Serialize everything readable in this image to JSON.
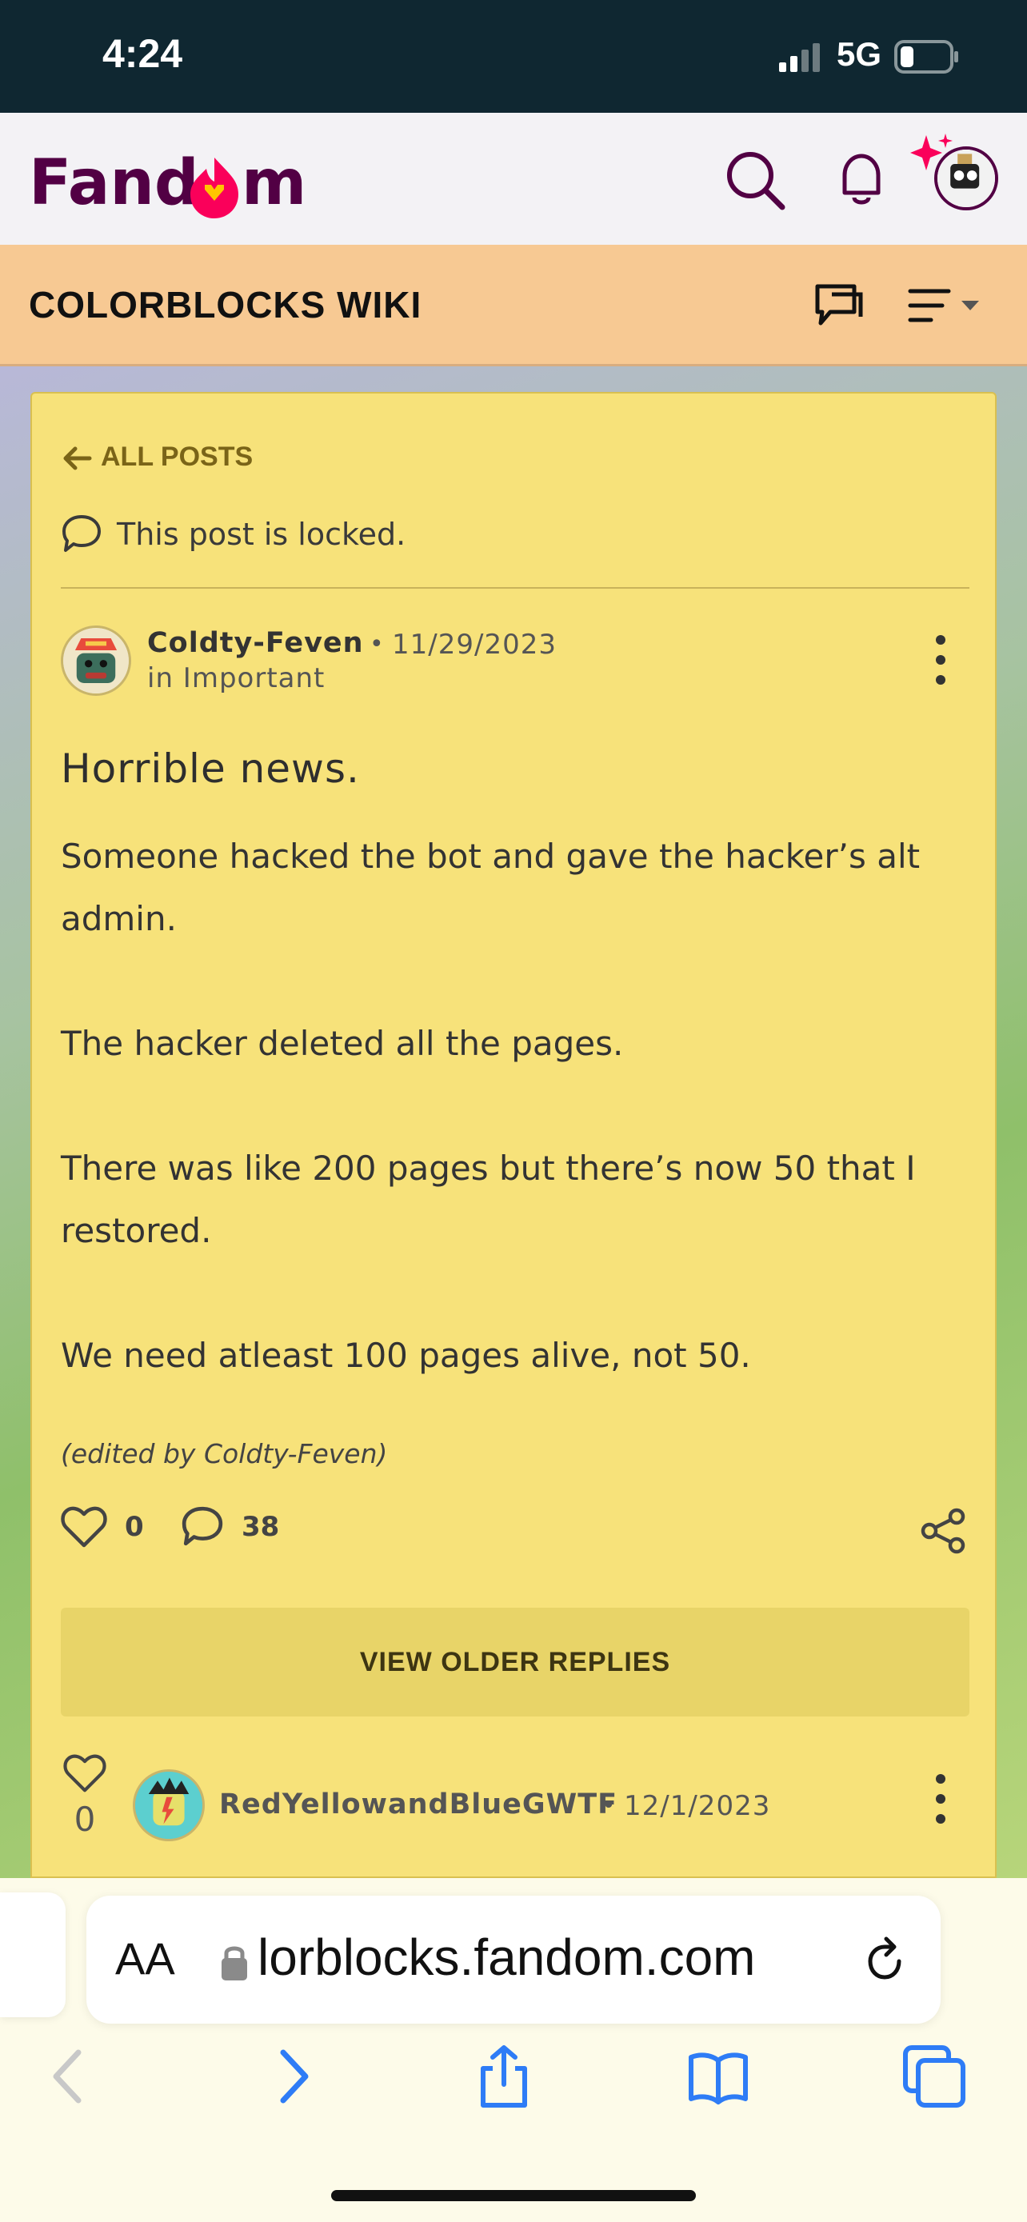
{
  "status_bar": {
    "time": "4:24",
    "network": "5G"
  },
  "fandom": {
    "logo_text": "Fandom"
  },
  "wiki": {
    "title": "COLORBLOCKS WIKI"
  },
  "post": {
    "back_label": "ALL POSTS",
    "locked_text": "This post is locked.",
    "author": "Coldty-Feven",
    "date": "11/29/2023",
    "category": "in Important",
    "title": "Horrible news.",
    "body": [
      "Someone hacked the bot and gave the hacker’s alt admin.",
      "The hacker deleted all the pages.",
      "There was like 200 pages but there’s now 50 that I restored.",
      "We need atleast 100 pages alive, not 50."
    ],
    "edited_note": "(edited by Coldty-Feven)",
    "likes": "0",
    "comments": "38"
  },
  "view_older_label": "VIEW OLDER REPLIES",
  "reply": {
    "author": "RedYellowandBlueGWTF",
    "date": "12/1/2023",
    "likes": "0"
  },
  "safari": {
    "aa_label": "AA",
    "url": "lorblocks.fandom.com"
  },
  "colors": {
    "accent": "#520044",
    "card": "#f7e27a",
    "wiki_bar": "#f7c993",
    "link_blue": "#2e7cf6"
  }
}
